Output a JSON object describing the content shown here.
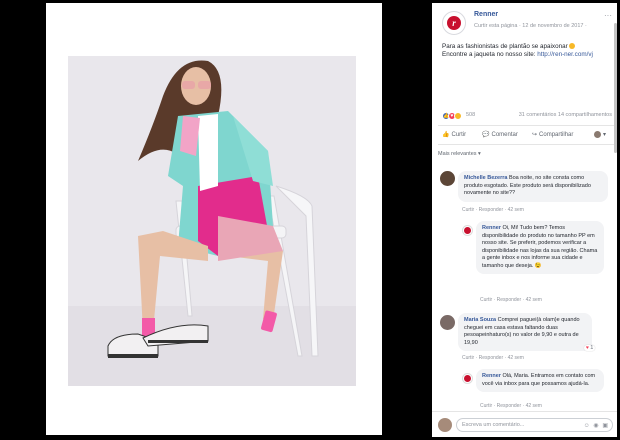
{
  "post": {
    "page_name": "Renner",
    "meta": "Curtir esta página · 12 de novembro de 2017 · ",
    "logo_letter": "r",
    "text_line1": "Para as fashionistas de plantão se apaixonar",
    "text_line2": "Encontre a jaqueta no nosso site: ",
    "link": "http://ren-ner.com/vj",
    "reactions_count": "508",
    "comments_shares": "31 comentários  14 compartilhamentos",
    "actions": {
      "like": "Curtir",
      "comment": "Comentar",
      "share": "Compartilhar"
    },
    "more_relevant": "Mais relevantes ▾"
  },
  "comments": [
    {
      "name": "Michelle Bezerra",
      "text": "Boa noite, no site consta como produto esgotado. Este produto será disponibilizado novamente no site??",
      "actions": "Curtir · Responder · 42 sem"
    },
    {
      "name": "Renner",
      "text": "Oi, Mi! Tudo bem? Temos disponibilidade do produto no tamanho PP em nosso site. Se preferir, podemos verificar a disponibilidade nas lojas da sua região. Chama a gente inbox e nos informe sua cidade e tamanho que deseja. 😉",
      "actions": "Curtir · Responder · 42 sem"
    },
    {
      "name": "Maria Souza",
      "text": "Comprei paguei(à olam)e quando cheguei em casa estava faltando duas pesoapeinhaturo(s) no valor de 9,90 e outra de 19,90",
      "actions": "Curtir · Responder · 42 sem",
      "reaction_count": "1"
    },
    {
      "name": "Renner",
      "text": "Olá, Maria. Entramos em contato com você via inbox para que possamos ajudá-la.",
      "actions": "Curtir · Responder · 42 sem"
    }
  ],
  "write_placeholder": "Escreva um comentário...",
  "colors": {
    "brand_red": "#c8102e",
    "link_blue": "#365899",
    "bubble_bg": "#f2f3f5"
  },
  "icons": [
    "like-icon",
    "love-icon",
    "wow-icon",
    "comment-icon",
    "share-icon",
    "more-dots-icon",
    "close-icon"
  ]
}
